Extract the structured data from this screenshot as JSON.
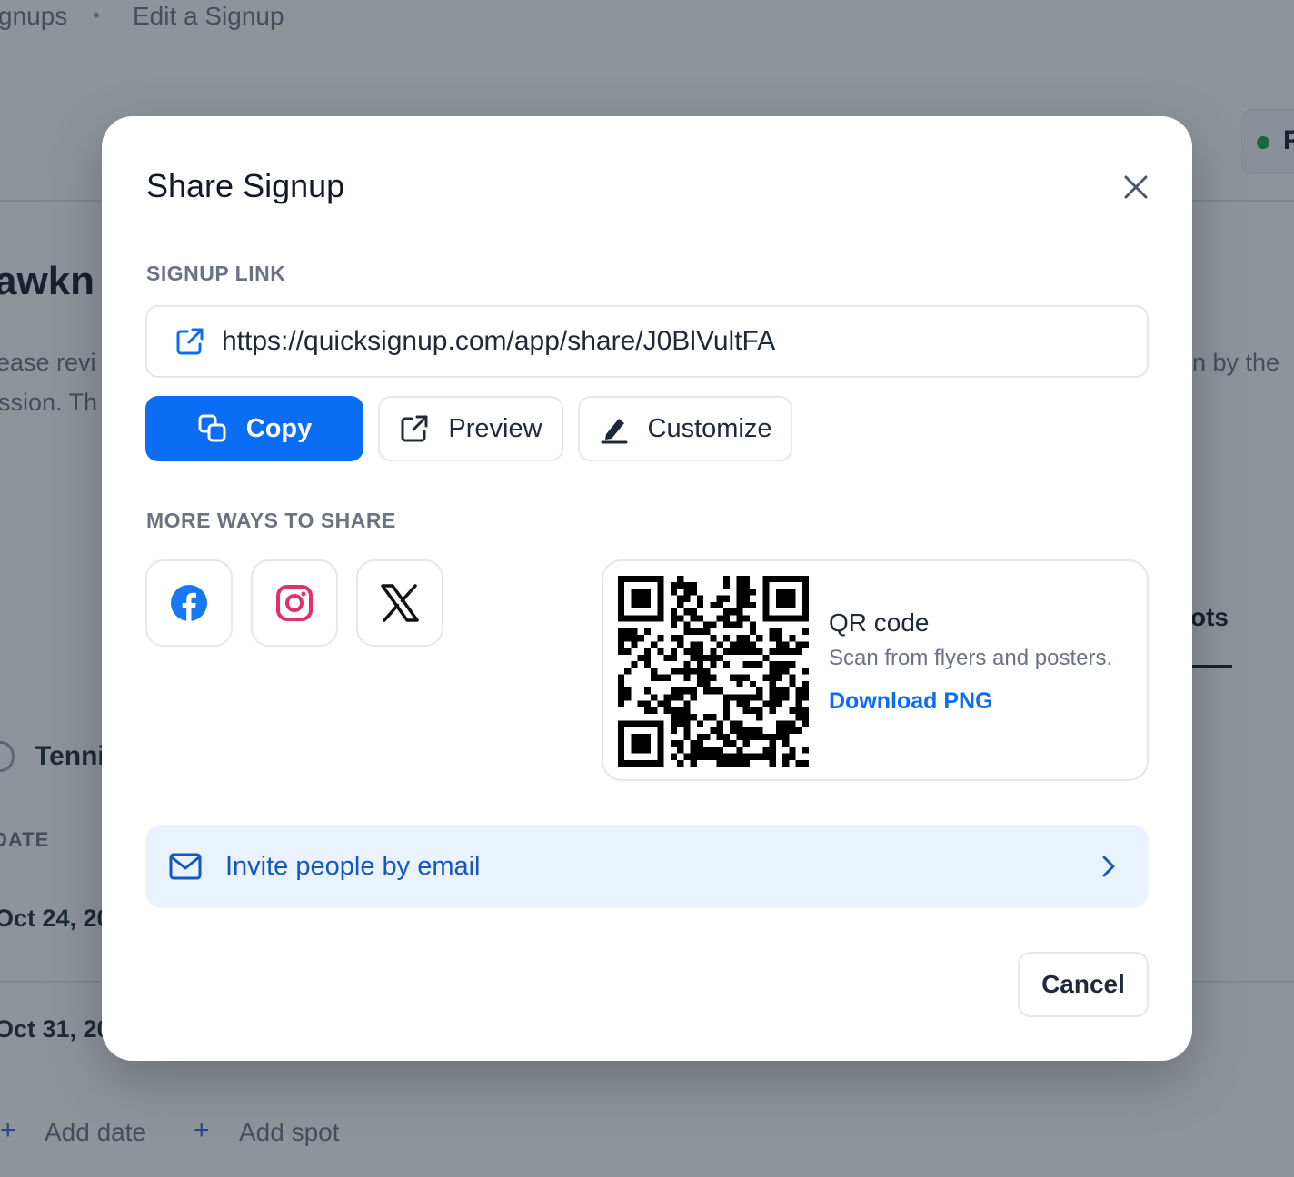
{
  "background": {
    "breadcrumb": {
      "item1": "gnups",
      "separator": "•",
      "item2": "Edit a Signup"
    },
    "page_title": "awkn",
    "description_line1_left": "ease revi",
    "description_line1_right": "n by the",
    "description_line2_left": "ssion. Th",
    "status_badge": "P",
    "tab_slots": "ots",
    "location": "Tenni",
    "column_header_date": "DATE",
    "row1_date": "Oct 24, 20",
    "row2_date": "Oct 31, 20",
    "add_date": "Add date",
    "add_spot": "Add spot",
    "plus_glyph": "+"
  },
  "modal": {
    "title": "Share Signup",
    "signup_link_label": "SIGNUP LINK",
    "signup_link_url": "https://quicksignup.com/app/share/J0BlVultFA",
    "copy_label": "Copy",
    "preview_label": "Preview",
    "customize_label": "Customize",
    "more_ways_label": "MORE WAYS TO SHARE",
    "qr": {
      "title": "QR code",
      "subtitle": "Scan from flyers and posters.",
      "download_label": "Download PNG"
    },
    "invite_label": "Invite people by email",
    "cancel_label": "Cancel"
  },
  "colors": {
    "primary": "#0b6df4",
    "invite_bg": "#eaf2fd",
    "instagram": "#e1306c",
    "facebook": "#1877f2"
  },
  "icons": [
    "close-icon",
    "external-link-icon",
    "copy-icon",
    "pencil-icon",
    "facebook-icon",
    "instagram-icon",
    "x-icon",
    "qr-code-icon",
    "mail-icon",
    "chevron-right-icon"
  ]
}
